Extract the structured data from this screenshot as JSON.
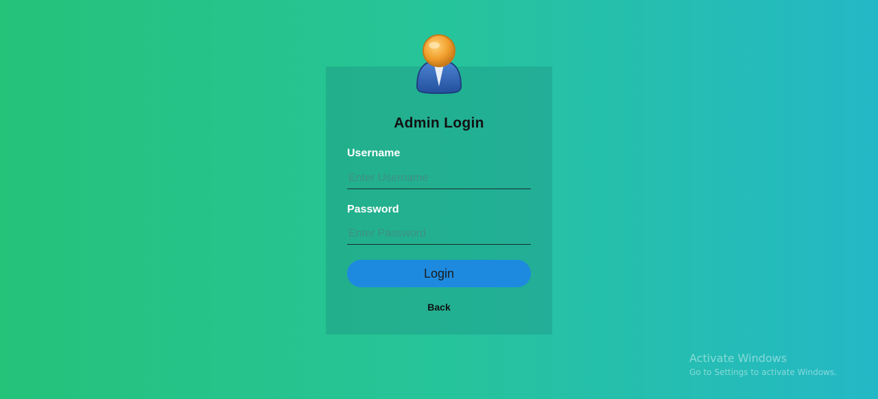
{
  "login": {
    "title": "Admin Login",
    "username_label": "Username",
    "username_placeholder": "Enter Username",
    "password_label": "Password",
    "password_placeholder": "Enter Password",
    "login_button": "Login",
    "back_link": "Back",
    "avatar_icon": "user-avatar-icon"
  },
  "watermark": {
    "title": "Activate Windows",
    "subtitle": "Go to Settings to activate Windows."
  },
  "colors": {
    "background_left": "#25c27a",
    "background_right": "#24b8c6",
    "button": "#1e8adf"
  }
}
